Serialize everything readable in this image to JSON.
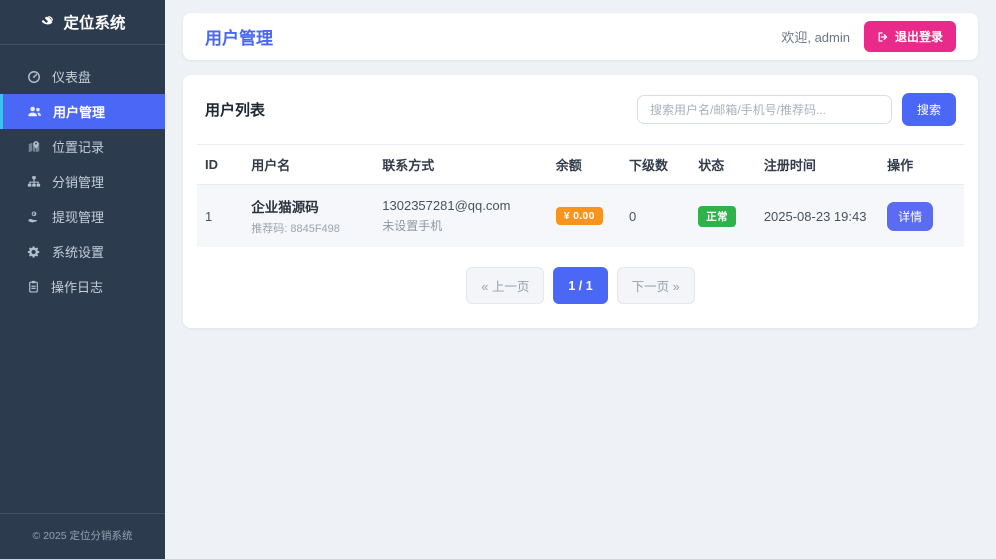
{
  "sidebar": {
    "logo": "定位系统",
    "items": [
      {
        "label": "仪表盘",
        "icon": "gauge-icon",
        "active": false
      },
      {
        "label": "用户管理",
        "icon": "users-icon",
        "active": true
      },
      {
        "label": "位置记录",
        "icon": "map-location-icon",
        "active": false
      },
      {
        "label": "分销管理",
        "icon": "sitemap-icon",
        "active": false
      },
      {
        "label": "提现管理",
        "icon": "hand-money-icon",
        "active": false
      },
      {
        "label": "系统设置",
        "icon": "gears-icon",
        "active": false
      },
      {
        "label": "操作日志",
        "icon": "clipboard-icon",
        "active": false
      }
    ],
    "footer": "© 2025 定位分销系统"
  },
  "header": {
    "title": "用户管理",
    "welcome": "欢迎, admin",
    "logout_label": "退出登录"
  },
  "panel": {
    "title": "用户列表",
    "search_placeholder": "搜索用户名/邮箱/手机号/推荐码...",
    "search_button": "搜索"
  },
  "table": {
    "headers": [
      "ID",
      "用户名",
      "联系方式",
      "余额",
      "下级数",
      "状态",
      "注册时间",
      "操作"
    ],
    "rows": [
      {
        "id": "1",
        "username": "企业猫源码",
        "ref_code": "推荐码: 8845F498",
        "email": "1302357281@qq.com",
        "phone": "未设置手机",
        "balance": "¥ 0.00",
        "subordinates": "0",
        "status": "正常",
        "registered": "2025-08-23 19:43",
        "action": "详情"
      }
    ]
  },
  "pagination": {
    "prev": "« 上一页",
    "current": "1 / 1",
    "next": "下一页 »"
  },
  "colors": {
    "accent_blue": "#4a67f5",
    "detail_blue": "#5b6cf2",
    "sidebar_bg": "#2d3b4f",
    "active_left_border": "#3fc1f0",
    "logout_pink": "#ea2a8a",
    "balance_orange": "#f7941d",
    "status_green": "#2eb34a",
    "page_bg": "#eef1f5",
    "row_stripe": "#f5f7fa"
  }
}
